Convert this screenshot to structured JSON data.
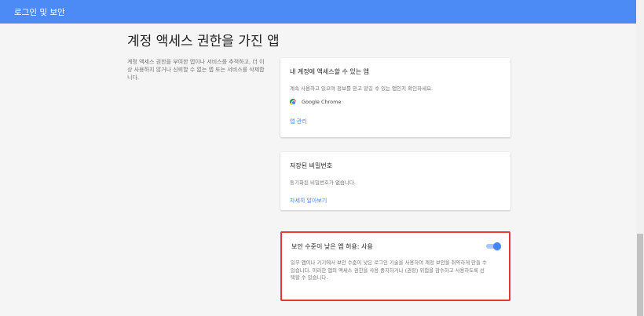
{
  "header": {
    "title": "로그인 및 보안"
  },
  "page": {
    "title": "계정 액세스 권한을 가진 앱",
    "description": "계정 액세스 권한을 부여한 앱이나 서비스를 추적하고, 더 이상 사용하지 않거나 신뢰할 수 없는 앱 또는 서비스를 삭제합니다."
  },
  "apps_card": {
    "title": "내 계정에 액세스할 수 있는 앱",
    "description": "계속 사용하고 있으며 정보를 믿고 맡길 수 있는 앱인지 확인하세요.",
    "apps": [
      {
        "name": "Google Chrome",
        "icon": "chrome-icon"
      }
    ],
    "manage_link": "앱 관리"
  },
  "passwords_card": {
    "title": "저장된 비밀번호",
    "description": "동기화된 비밀번호가 없습니다.",
    "learn_more_link": "자세히 알아보기"
  },
  "less_secure_card": {
    "title": "보안 수준이 낮은 앱 허용: 사용",
    "description": "일부 앱이나 기기에서 보안 수준이 낮은 로그인 기술을 사용하여 계정 보안을 취약하게 만들 수 있습니다. 이러한 앱의 액세스 권한을 사용 중지하거나 (권장) 위험을 감수하고 사용하도록 선택할 수 있습니다.",
    "toggle_on": true
  },
  "colors": {
    "header_bg": "#4c8bf5",
    "link": "#4285f4",
    "highlight_border": "#e53935"
  }
}
